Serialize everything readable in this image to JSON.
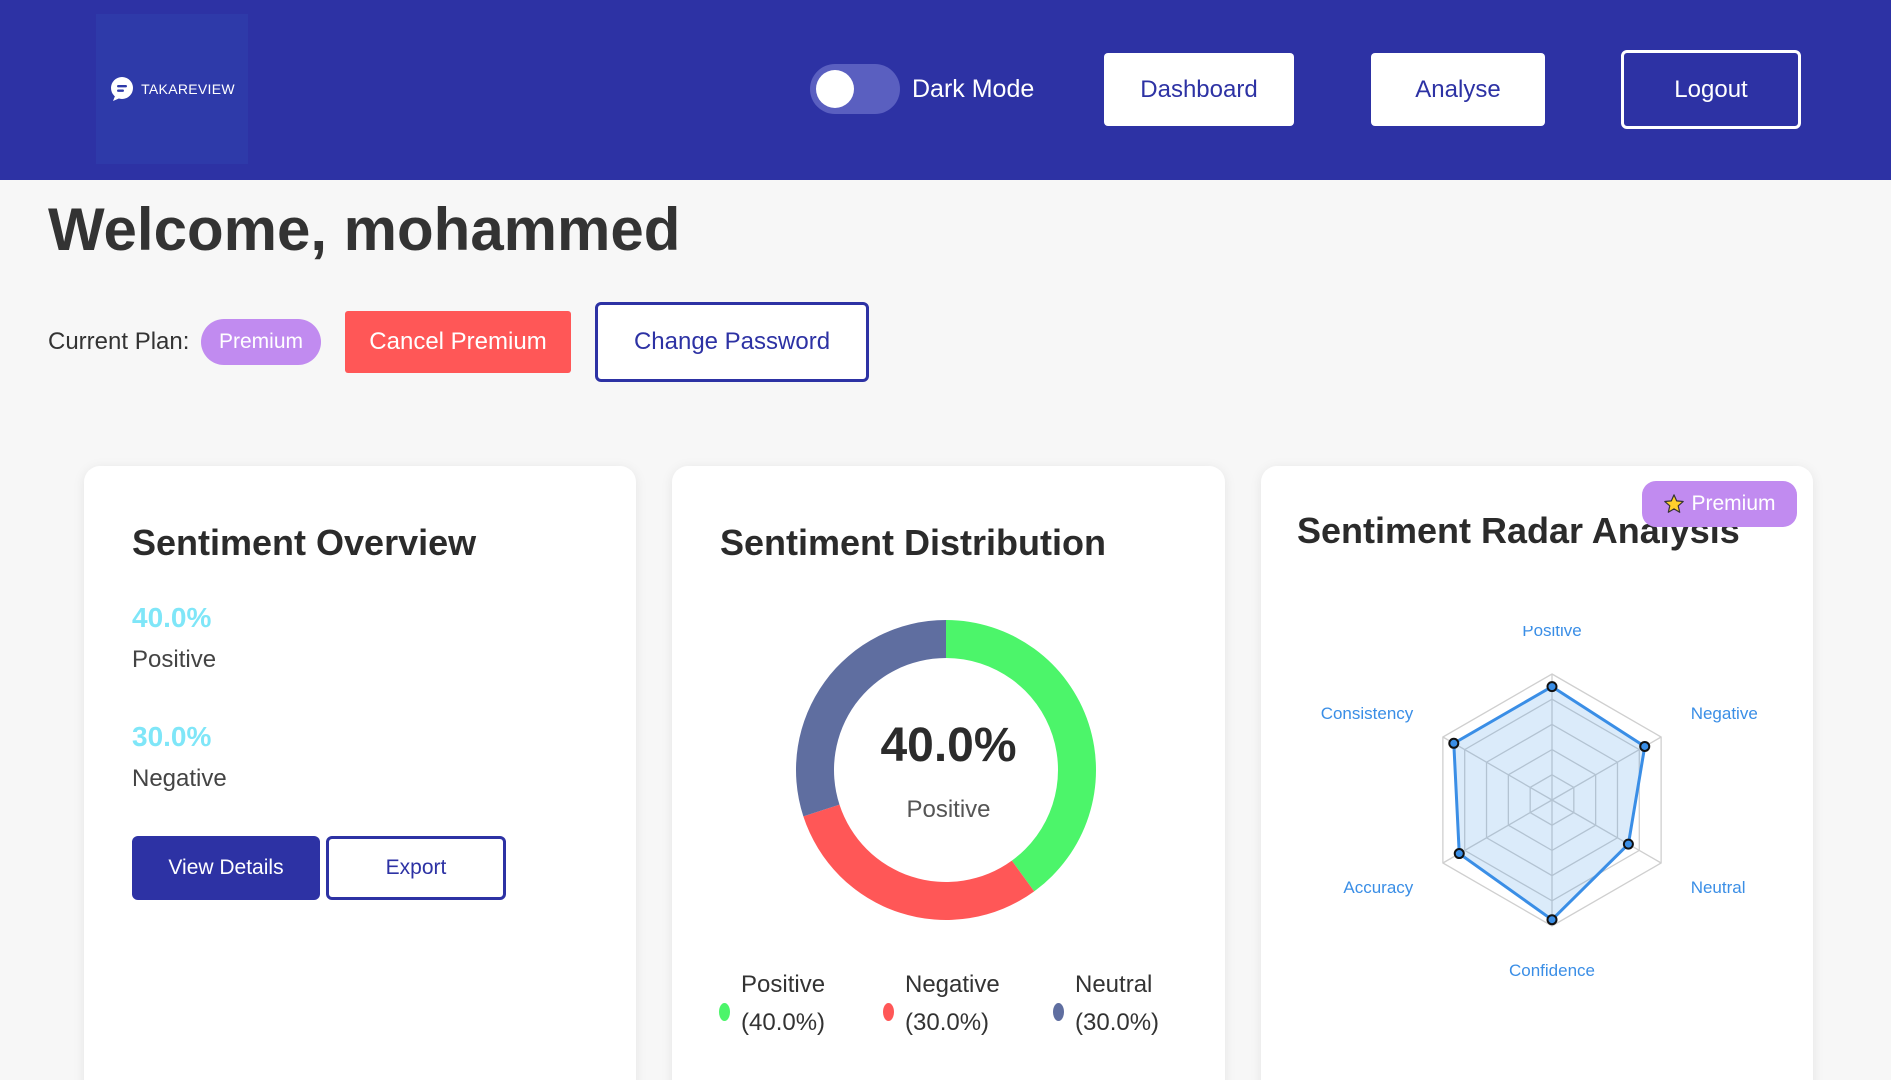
{
  "header": {
    "logo_text": "TAKAREVIEW",
    "dark_mode_label": "Dark Mode",
    "nav": {
      "dashboard": "Dashboard",
      "analyse": "Analyse",
      "logout": "Logout"
    }
  },
  "welcome": "Welcome, mohammed",
  "plan": {
    "label": "Current Plan:",
    "badge": "Premium",
    "cancel_label": "Cancel Premium",
    "change_password_label": "Change Password"
  },
  "overview": {
    "title": "Sentiment Overview",
    "stats": [
      {
        "value": "40.0%",
        "label": "Positive"
      },
      {
        "value": "30.0%",
        "label": "Negative"
      }
    ],
    "view_details_label": "View Details",
    "export_label": "Export"
  },
  "distribution": {
    "title": "Sentiment Distribution",
    "center_value": "40.0%",
    "center_label": "Positive",
    "legend": [
      {
        "name": "Positive",
        "pct": "(40.0%)",
        "color": "#4cf56a"
      },
      {
        "name": "Negative",
        "pct": "(30.0%)",
        "color": "#ff5757"
      },
      {
        "name": "Neutral",
        "pct": "(30.0%)",
        "color": "#5f6ea0"
      }
    ]
  },
  "radar": {
    "title": "Sentiment Radar Analysis",
    "premium_tag": "Premium",
    "accent": "#3a8ee6"
  },
  "chart_data": [
    {
      "type": "pie",
      "categories": [
        "Positive",
        "Negative",
        "Neutral"
      ],
      "values": [
        40,
        30,
        30
      ],
      "colors": [
        "#4cf56a",
        "#ff5757",
        "#5f6ea0"
      ],
      "title": "Sentiment Distribution"
    },
    {
      "type": "radar",
      "categories": [
        "Positive",
        "Negative",
        "Neutral",
        "Confidence",
        "Accuracy",
        "Consistency"
      ],
      "values": [
        0.9,
        0.85,
        0.7,
        0.95,
        0.85,
        0.9
      ],
      "rmax": 1,
      "title": "Sentiment Radar Analysis"
    }
  ]
}
